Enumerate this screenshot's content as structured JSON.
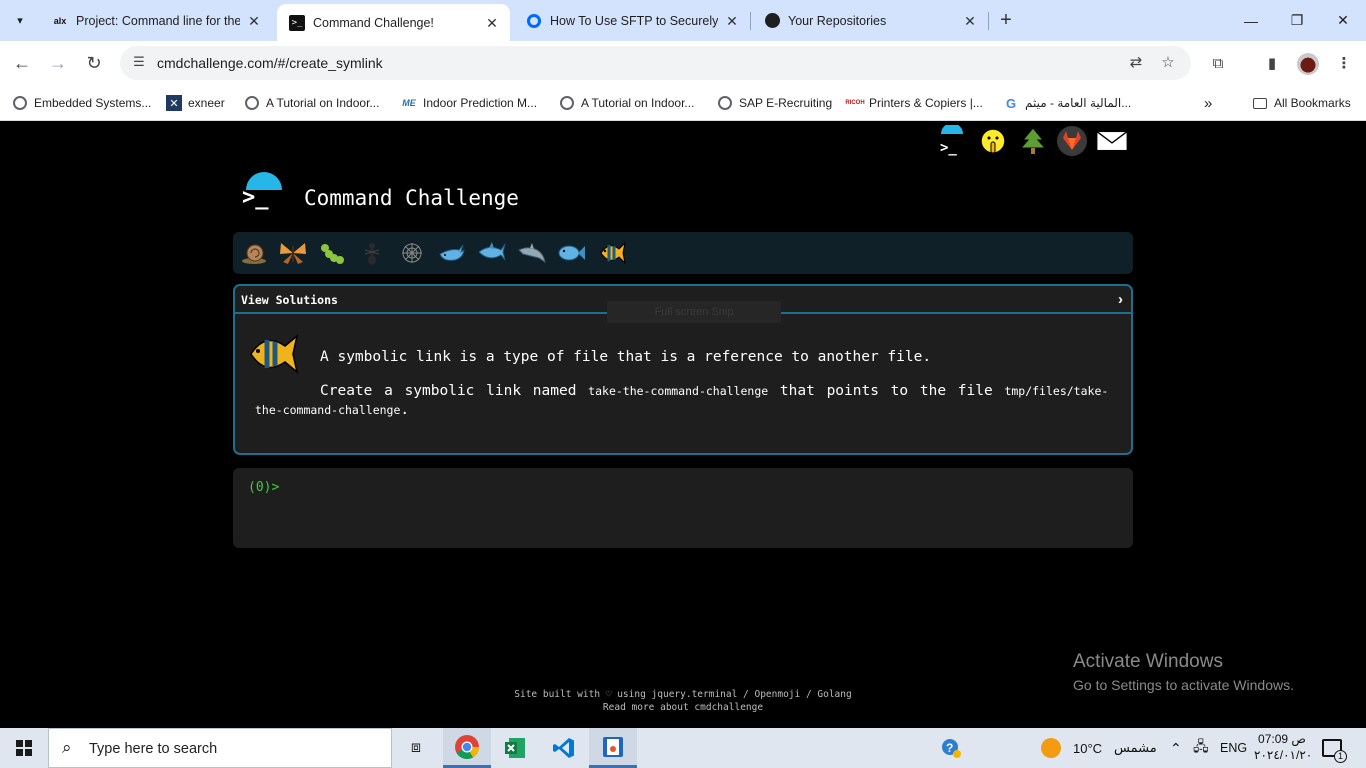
{
  "browser": {
    "tabs": [
      {
        "title": "Project: Command line for the",
        "favicon": "alx-logo"
      },
      {
        "title": "Command Challenge!",
        "favicon": "terminal-icon",
        "active": true
      },
      {
        "title": "How To Use SFTP to Securely Tr",
        "favicon": "digitalocean-icon"
      },
      {
        "title": "Your Repositories",
        "favicon": "github-icon"
      }
    ],
    "favicon_texts": {
      "alx": "alx"
    },
    "url": "cmdchallenge.com/#/create_symlink",
    "bookmarks": [
      {
        "label": "Embedded Systems..."
      },
      {
        "label": "exneer"
      },
      {
        "label": "A Tutorial on Indoor..."
      },
      {
        "label": "Indoor Prediction M..."
      },
      {
        "label": "A Tutorial on Indoor..."
      },
      {
        "label": "SAP E-Recruiting"
      },
      {
        "label": "Printers & Copiers |..."
      },
      {
        "label": "المالية العامة - ميثم..."
      }
    ],
    "bookmarks_overflow": "»",
    "all_bookmarks": "All Bookmarks"
  },
  "page": {
    "site_title": "Command Challenge",
    "level_icons": [
      "snail",
      "butterfly",
      "caterpillar",
      "ant",
      "spider-web",
      "whale",
      "shark",
      "dolphin",
      "fish",
      "tropical-fish"
    ],
    "challenge": {
      "header": "View Solutions",
      "ghost_button": "Full screen Snip",
      "line1": "A symbolic link is a type of file that is a reference to another file.",
      "line2_pre": "Create a symbolic link named ",
      "line2_code1": "take-the-command-challenge",
      "line2_mid": " that points to the file ",
      "line2_code2": "tmp/files/take-the-command-challenge",
      "line2_end": "."
    },
    "terminal_prompt": "(0)>",
    "footer_line1": "Site built with ♡ using jquery.terminal / Openmoji / Golang",
    "footer_line2": "Read more about cmdchallenge"
  },
  "watermark": {
    "title": "Activate Windows",
    "subtitle": "Go to Settings to activate Windows."
  },
  "taskbar": {
    "search_placeholder": "Type here to search",
    "weather_temp": "10°C",
    "weather_text": "مشمس",
    "language": "ENG",
    "time": "07:09 ص",
    "date": "٢٠٢٤/٠١/٢٠",
    "notification_count": "1"
  }
}
